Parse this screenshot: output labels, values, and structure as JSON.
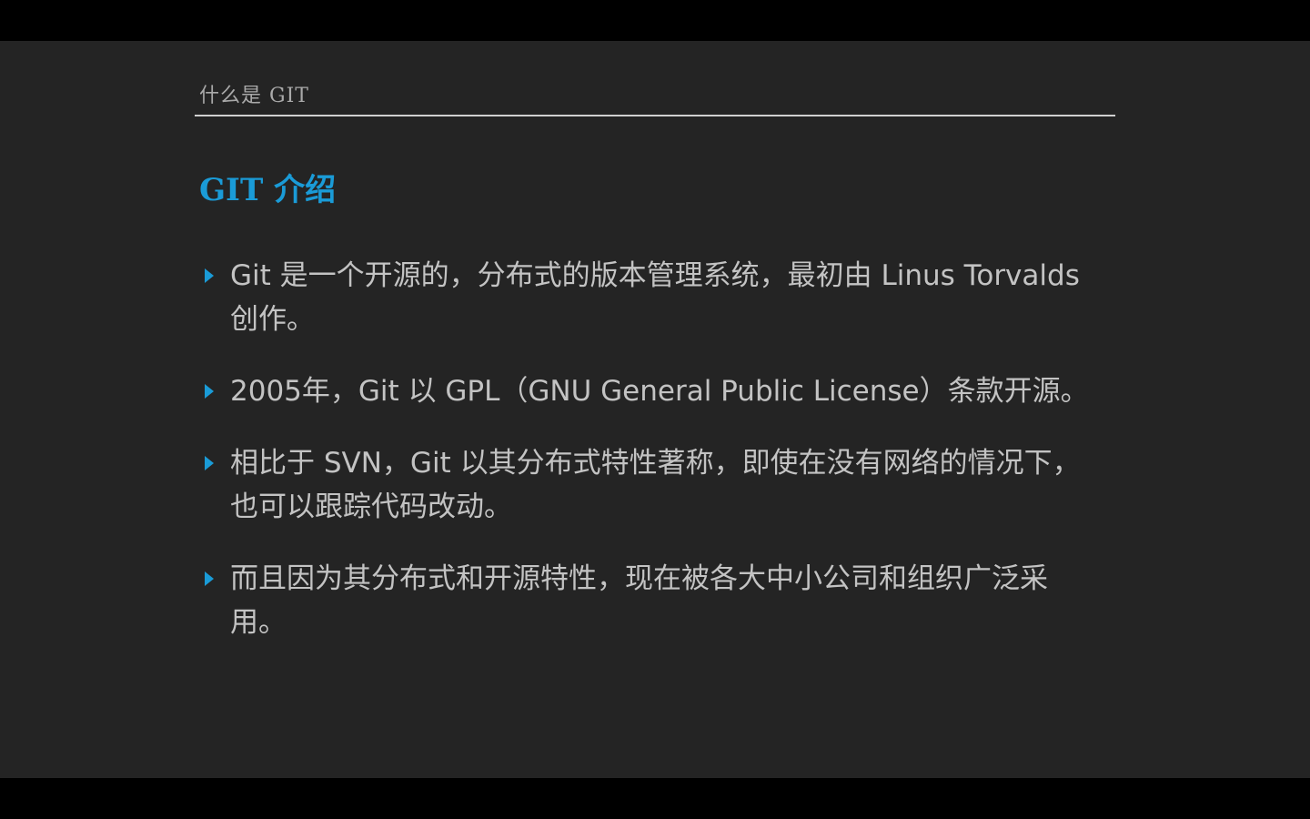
{
  "header": {
    "section_title": "什么是 GIT"
  },
  "slide": {
    "title": "GIT 介绍",
    "bullets": [
      "Git 是一个开源的，分布式的版本管理系统，最初由 Linus Torvalds 创作。",
      "2005年，Git 以 GPL（GNU General Public License）条款开源。",
      "相比于 SVN，Git 以其分布式特性著称，即使在没有网络的情况下，也可以跟踪代码改动。",
      "而且因为其分布式和开源特性，现在被各大中小公司和组织广泛采用。"
    ]
  },
  "colors": {
    "accent": "#1a9bd7",
    "text": "#c3c3c3",
    "background": "#242424"
  },
  "icons": {
    "bullet": "triangle-right-icon"
  }
}
